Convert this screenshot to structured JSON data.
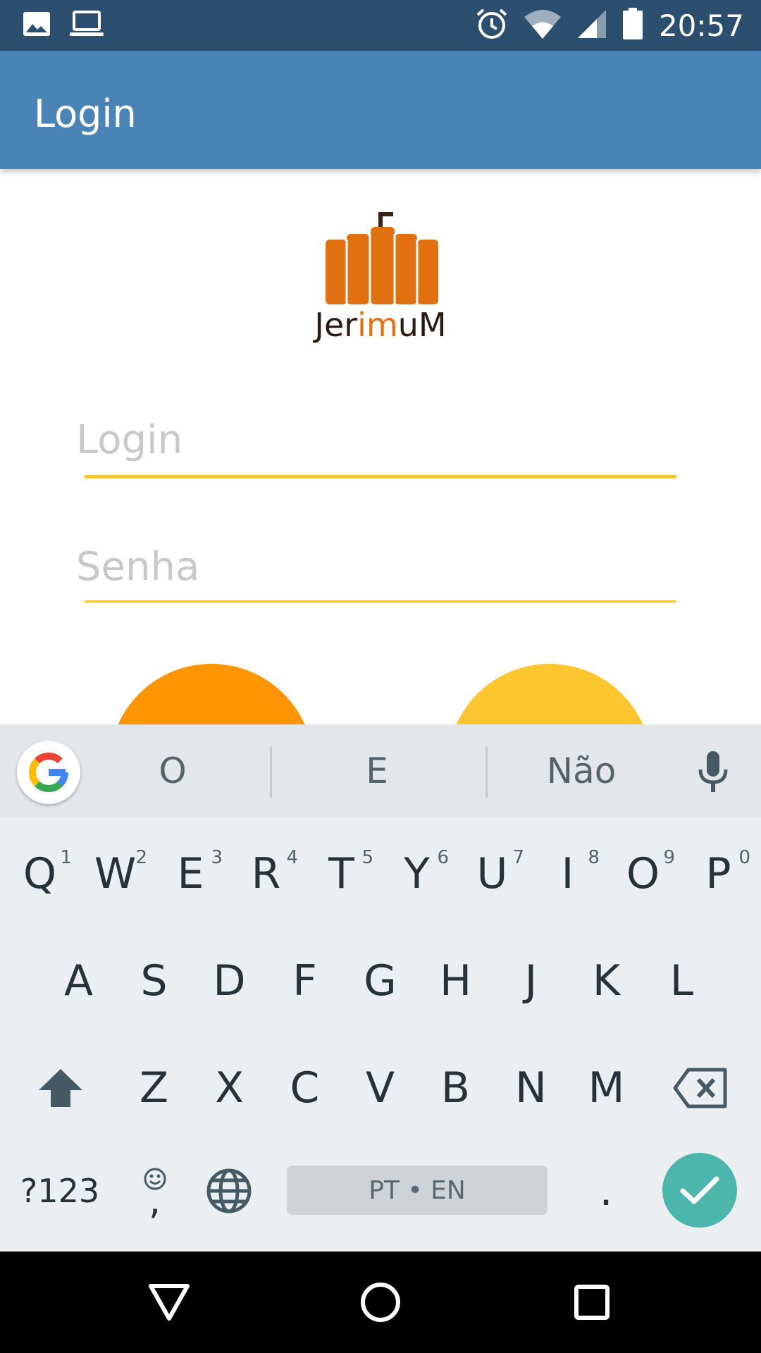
{
  "status_bar": {
    "time": "20:57",
    "icons": [
      "image-notification-icon",
      "laptop-notification-icon",
      "alarm-icon",
      "wifi-icon",
      "cell-signal-icon",
      "battery-icon"
    ]
  },
  "app_bar": {
    "title": "Login"
  },
  "logo": {
    "wordmark_pre": "Jer",
    "wordmark_mid": "im",
    "wordmark_post": "uM"
  },
  "form": {
    "login": {
      "placeholder": "Login",
      "value": ""
    },
    "senha": {
      "placeholder": "Senha",
      "value": ""
    }
  },
  "colors": {
    "status_bar": "#2d4f6f",
    "app_bar": "#4a84b6",
    "underline": "#f5c53c",
    "button_orange": "#fd9503",
    "button_yellow": "#fdc631",
    "enter_key": "#4db6ac"
  },
  "keyboard": {
    "suggestions": [
      "O",
      "E",
      "Não"
    ],
    "row1": [
      {
        "label": "Q",
        "hint": "1"
      },
      {
        "label": "W",
        "hint": "2"
      },
      {
        "label": "E",
        "hint": "3"
      },
      {
        "label": "R",
        "hint": "4"
      },
      {
        "label": "T",
        "hint": "5"
      },
      {
        "label": "Y",
        "hint": "6"
      },
      {
        "label": "U",
        "hint": "7"
      },
      {
        "label": "I",
        "hint": "8"
      },
      {
        "label": "O",
        "hint": "9"
      },
      {
        "label": "P",
        "hint": "0"
      }
    ],
    "row2": [
      "A",
      "S",
      "D",
      "F",
      "G",
      "H",
      "J",
      "K",
      "L"
    ],
    "row3": [
      "Z",
      "X",
      "C",
      "V",
      "B",
      "N",
      "M"
    ],
    "symbols_label": "?123",
    "emoji_comma": ",",
    "space_label": "PT • EN",
    "period": "."
  }
}
